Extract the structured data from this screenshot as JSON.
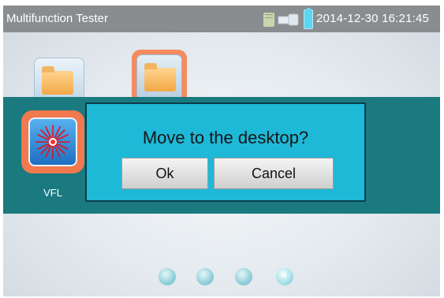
{
  "statusbar": {
    "title": "Multifunction Tester",
    "datetime": "2014-12-30 16:21:45",
    "icons": [
      "sd-card-icon",
      "usb-icon",
      "battery-icon"
    ]
  },
  "desktop": {
    "apps": [
      {
        "label": "VFL",
        "icon": "laser-icon"
      }
    ]
  },
  "dialog": {
    "message": "Move to the desktop?",
    "ok_label": "Ok",
    "cancel_label": "Cancel"
  },
  "pager": {
    "active_page": "4"
  },
  "colors": {
    "status_bar": "#8a8d90",
    "band": "#1a7a80",
    "dialog": "#1fb9d8",
    "highlight": "#f0794e"
  }
}
